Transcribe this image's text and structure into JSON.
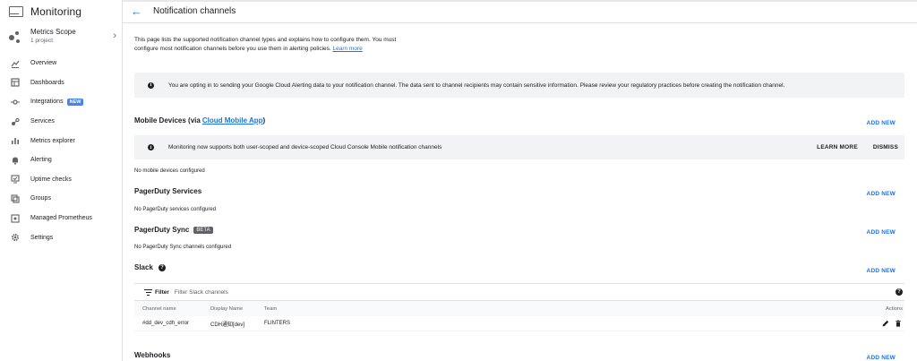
{
  "app": {
    "title": "Monitoring"
  },
  "scope": {
    "title": "Metrics Scope",
    "subtitle": "1 project"
  },
  "sidebar": {
    "items": [
      {
        "label": "Overview",
        "icon": "chart-line-icon"
      },
      {
        "label": "Dashboards",
        "icon": "dashboard-icon"
      },
      {
        "label": "Integrations",
        "icon": "integrations-icon",
        "badge": "NEW"
      },
      {
        "label": "Services",
        "icon": "services-icon"
      },
      {
        "label": "Metrics explorer",
        "icon": "bar-chart-icon"
      },
      {
        "label": "Alerting",
        "icon": "bell-icon"
      },
      {
        "label": "Uptime checks",
        "icon": "uptime-icon"
      },
      {
        "label": "Groups",
        "icon": "groups-icon"
      },
      {
        "label": "Managed Prometheus",
        "icon": "prometheus-icon"
      },
      {
        "label": "Settings",
        "icon": "gear-icon"
      }
    ]
  },
  "header": {
    "title": "Notification channels"
  },
  "intro": {
    "text": "This page lists the supported notification channel types and explains how to configure them. You must configure most notification channels before you use them in alerting policies.",
    "link": "Learn more"
  },
  "info_banner": {
    "text": "You are opting in to sending your Google Cloud Alerting data to your notification channel. The data sent to channel recipients may contain sensitive information. Please review your regulatory practices before creating the notification channel."
  },
  "sections": {
    "mobile": {
      "title_prefix": "Mobile Devices (via",
      "title_link": "Cloud Mobile App",
      "title_suffix": ")",
      "add": "ADD NEW",
      "banner_text": "Monitoring now supports both user-scoped and device-scoped Cloud Console Mobile notification channels",
      "learn_more": "LEARN MORE",
      "dismiss": "DISMISS",
      "empty": "No mobile devices configured"
    },
    "pagerduty": {
      "title": "PagerDuty Services",
      "add": "ADD NEW",
      "empty": "No PagerDuty services configured"
    },
    "pagerduty_sync": {
      "title": "PagerDuty Sync",
      "badge": "BETA",
      "add": "ADD NEW",
      "empty": "No PagerDuty Sync channels configured"
    },
    "slack": {
      "title": "Slack",
      "add": "ADD NEW",
      "filter_label": "Filter",
      "filter_placeholder": "Filter Slack channels",
      "columns": [
        "Channel name",
        "Display Name",
        "Team",
        "Actions"
      ],
      "rows": [
        {
          "channel": "#dd_dev_cdh_error",
          "display": "CDH通知[dev]",
          "team": "FLINTERS"
        }
      ]
    },
    "webhooks": {
      "title": "Webhooks",
      "add": "ADD NEW"
    }
  },
  "colors": {
    "accent": "#1a73e8",
    "badge_new": "#4285f4",
    "banner_bg": "#f1f3f4"
  }
}
